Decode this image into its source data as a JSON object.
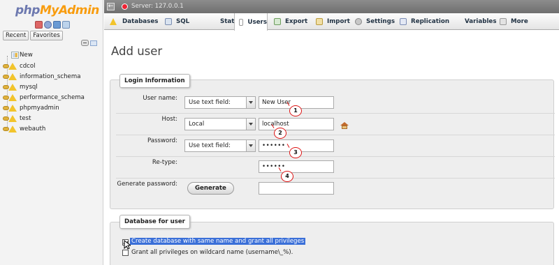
{
  "app": {
    "logo_php": "php",
    "logo_myadmin": "MyAdmin"
  },
  "left_panel": {
    "tabs": [
      "Recent",
      "Favorites"
    ],
    "tree": [
      {
        "label": "New",
        "icon": "new-database-icon"
      },
      {
        "label": "cdcol",
        "icon": "database-icon"
      },
      {
        "label": "information_schema",
        "icon": "database-icon"
      },
      {
        "label": "mysql",
        "icon": "database-icon"
      },
      {
        "label": "performance_schema",
        "icon": "database-icon"
      },
      {
        "label": "phpmyadmin",
        "icon": "database-icon"
      },
      {
        "label": "test",
        "icon": "database-icon"
      },
      {
        "label": "webauth",
        "icon": "database-icon"
      }
    ]
  },
  "server_bar": {
    "text": "Server: 127.0.0.1"
  },
  "top_nav": {
    "tabs": [
      {
        "label": "Databases",
        "icon": "databases-icon"
      },
      {
        "label": "SQL",
        "icon": "sql-icon"
      },
      {
        "label": "Status",
        "icon": "status-icon"
      },
      {
        "label": "Users",
        "icon": "users-icon",
        "active": true
      },
      {
        "label": "Export",
        "icon": "export-icon"
      },
      {
        "label": "Import",
        "icon": "import-icon"
      },
      {
        "label": "Settings",
        "icon": "settings-icon"
      },
      {
        "label": "Replication",
        "icon": "replication-icon"
      },
      {
        "label": "Variables",
        "icon": "variables-icon"
      },
      {
        "label": "More",
        "icon": "more-icon"
      }
    ]
  },
  "page": {
    "title": "Add user"
  },
  "login_info": {
    "legend": "Login Information",
    "username": {
      "label": "User name:",
      "select": "Use text field:",
      "value": "New User"
    },
    "host": {
      "label": "Host:",
      "select": "Local",
      "value": "localhost"
    },
    "password": {
      "label": "Password:",
      "select": "Use text field:",
      "value": "••••••"
    },
    "retype": {
      "label": "Re-type:",
      "value": "••••••"
    },
    "generate": {
      "label": "Generate password:",
      "button": "Generate",
      "value": ""
    }
  },
  "annotations": [
    "1",
    "2",
    "3",
    "4"
  ],
  "database_for_user": {
    "legend": "Database for user",
    "option1": "Create database with same name and grant all privileges",
    "option2": "Grant all privileges on wildcard name (username\\_%)."
  },
  "colors": {
    "accent_selection": "#3a6fd8",
    "annotation_red": "#d11111",
    "logo_php": "#6c78af",
    "logo_myadmin": "#f89c0e"
  }
}
